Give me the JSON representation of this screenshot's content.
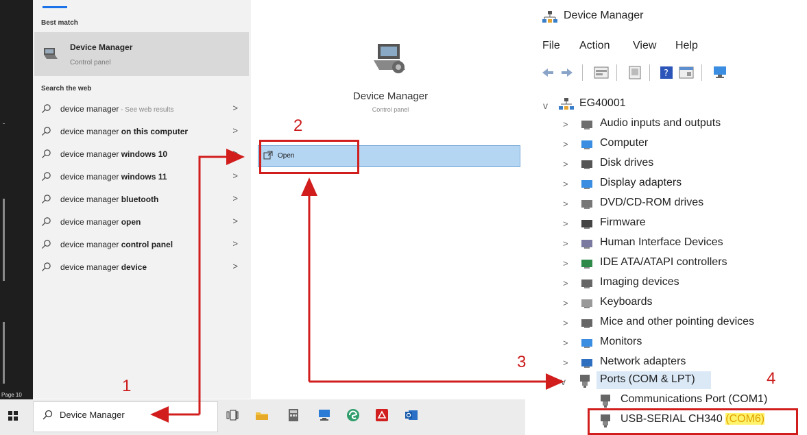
{
  "search_panel": {
    "best_match_header": "Best match",
    "best_match": {
      "title": "Device Manager",
      "subtitle": "Control panel"
    },
    "search_web_header": "Search the web",
    "suggestions": [
      {
        "prefix": "device manager",
        "bold": "",
        "suffix": " - See web results"
      },
      {
        "prefix": "device manager ",
        "bold": "on this computer",
        "suffix": ""
      },
      {
        "prefix": "device manager ",
        "bold": "windows 10",
        "suffix": ""
      },
      {
        "prefix": "device manager ",
        "bold": "windows 11",
        "suffix": ""
      },
      {
        "prefix": "device manager ",
        "bold": "bluetooth",
        "suffix": ""
      },
      {
        "prefix": "device manager ",
        "bold": "open",
        "suffix": ""
      },
      {
        "prefix": "device manager ",
        "bold": "control panel",
        "suffix": ""
      },
      {
        "prefix": "device manager ",
        "bold": "device",
        "suffix": ""
      }
    ],
    "chevron": ">",
    "detail": {
      "title": "Device Manager",
      "subtitle": "Control panel",
      "open_label": "Open"
    },
    "search_query": "Device Manager",
    "page_label": "Page 10"
  },
  "device_manager": {
    "title": "Device Manager",
    "menu": [
      "File",
      "Action",
      "View",
      "Help"
    ],
    "root": "EG40001",
    "categories": [
      "Audio inputs and outputs",
      "Computer",
      "Disk drives",
      "Display adapters",
      "DVD/CD-ROM drives",
      "Firmware",
      "Human Interface Devices",
      "IDE ATA/ATAPI controllers",
      "Imaging devices",
      "Keyboards",
      "Mice and other pointing devices",
      "Monitors",
      "Network adapters"
    ],
    "ports": {
      "label": "Ports (COM & LPT)",
      "children": [
        "Communications Port (COM1)"
      ],
      "usb_device": {
        "name": "USB-SERIAL CH340 ",
        "port": "(COM6)"
      }
    },
    "expand_glyph": ">",
    "collapse_glyph": "v"
  },
  "annotations": {
    "step1": "1",
    "step2": "2",
    "step3": "3",
    "step4": "4"
  },
  "colors": {
    "annotation_red": "#d21d1d",
    "highlight_yellow": "#fff36b",
    "selection_blue": "#b5d6f3"
  }
}
